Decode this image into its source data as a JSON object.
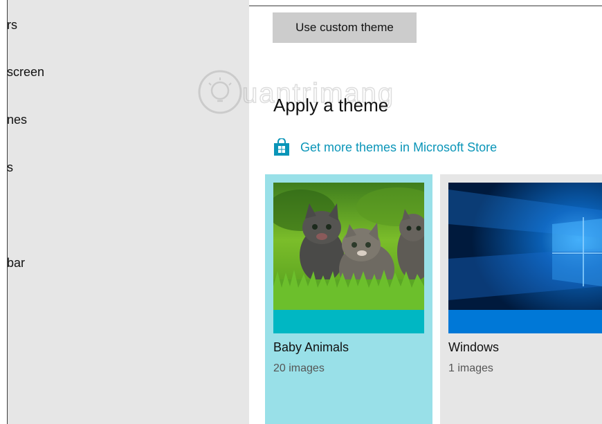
{
  "sidebar": {
    "items": [
      {
        "label": "rs"
      },
      {
        "label": "screen"
      },
      {
        "label": "nes"
      },
      {
        "label": "s"
      },
      {
        "label": "bar"
      }
    ]
  },
  "main": {
    "custom_theme_button": "Use custom theme",
    "section_title": "Apply a theme",
    "store_link": "Get more themes in Microsoft Store",
    "themes": [
      {
        "name": "Baby Animals",
        "count": "20 images",
        "accent": "#00b7c3",
        "selected": true
      },
      {
        "name": "Windows",
        "count": "1 images",
        "accent": "#0078d7",
        "selected": false
      }
    ]
  },
  "watermark": {
    "text": "Quantrimang"
  },
  "colors": {
    "link": "#0a95b8",
    "selected_tile": "#99e0e8",
    "sidebar_bg": "#e6e6e6",
    "button_bg": "#cccccc"
  }
}
